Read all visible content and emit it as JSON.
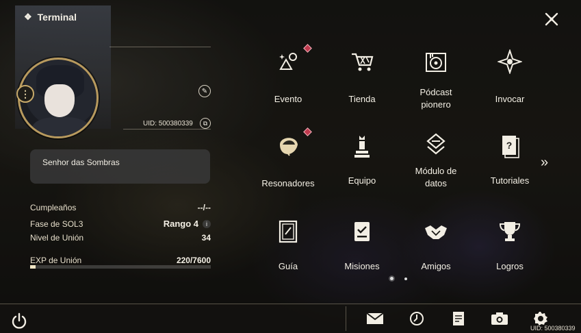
{
  "header": {
    "title": "Terminal",
    "title_icon": "terminal-diamond-icon",
    "close_icon": "close-icon"
  },
  "profile": {
    "uid": "UID: 500380339",
    "name": "Senhor das Sombras",
    "menu_symbol": "⋮",
    "edit_symbol": "✎",
    "copy_symbol": "⧉"
  },
  "stats": {
    "birthday_label": "Cumpleaños",
    "birthday_value": "--/--",
    "sol3_label": "Fase de SOL3",
    "sol3_value": "Rango 4",
    "info_symbol": "i",
    "union_level_label": "Nivel de Unión",
    "union_level_value": "34",
    "union_exp_label": "EXP de Unión",
    "union_exp_value": "220/7600",
    "union_exp_fraction": 0.029
  },
  "grid": [
    {
      "label": "Evento",
      "icon": "event-icon",
      "badge": true
    },
    {
      "label": "Tienda",
      "icon": "shop-cart-icon",
      "badge": false
    },
    {
      "label": "Pódcast pionero",
      "icon": "podcast-icon",
      "badge": false
    },
    {
      "label": "Invocar",
      "icon": "summon-star-icon",
      "badge": false
    },
    {
      "label": "Resonadores",
      "icon": "resonator-icon",
      "badge": true
    },
    {
      "label": "Equipo",
      "icon": "team-chess-icon",
      "badge": false
    },
    {
      "label": "Módulo de datos",
      "icon": "data-module-icon",
      "badge": false
    },
    {
      "label": "Tutoriales",
      "icon": "tutorial-book-icon",
      "badge": false
    },
    {
      "label": "Guía",
      "icon": "guide-book-icon",
      "badge": false
    },
    {
      "label": "Misiones",
      "icon": "quests-icon",
      "badge": false
    },
    {
      "label": "Amigos",
      "icon": "friends-handshake-icon",
      "badge": false
    },
    {
      "label": "Logros",
      "icon": "achievements-trophy-icon",
      "badge": false
    }
  ],
  "navigation": {
    "next_symbol": "»",
    "page_count": 2,
    "active_page": 1
  },
  "bottom_bar": {
    "icons": [
      "mail-icon",
      "clock-icon",
      "notes-icon",
      "camera-icon",
      "settings-gear-icon"
    ],
    "uid": "UID: 500380339",
    "power_icon": "power-icon"
  }
}
